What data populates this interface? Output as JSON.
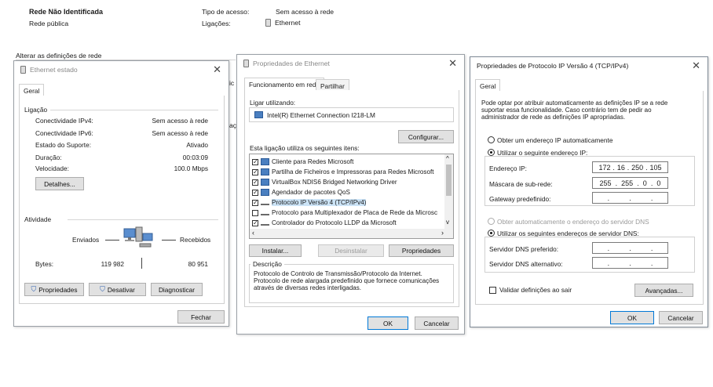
{
  "background": {
    "network_name": "Rede Não Identificada",
    "network_type": "Rede pública",
    "access_type_label": "Tipo de acesso:",
    "access_type_value": "Sem acesso à rede",
    "connections_label": "Ligações:",
    "connections_value": "Ethernet",
    "change_settings": "Alterar as definições de rede",
    "partial_1": "ic",
    "partial_2": "aç"
  },
  "status_window": {
    "title": "Ethernet estado",
    "tab": "Geral",
    "connection_label": "Ligação",
    "rows": [
      {
        "label": "Conectividade IPv4:",
        "value": "Sem acesso à rede"
      },
      {
        "label": "Conectividade IPv6:",
        "value": "Sem acesso à rede"
      },
      {
        "label": "Estado do Suporte:",
        "value": "Ativado"
      },
      {
        "label": "Duração:",
        "value": "00:03:09"
      },
      {
        "label": "Velocidade:",
        "value": "100.0 Mbps"
      }
    ],
    "details_button": "Detalhes...",
    "activity_label": "Atividade",
    "sent_label": "Enviados",
    "received_label": "Recebidos",
    "bytes_label": "Bytes:",
    "bytes_sent": "119 982",
    "bytes_received": "80 951",
    "properties_button": "Propriedades",
    "disable_button": "Desativar",
    "diagnose_button": "Diagnosticar",
    "close_button": "Fechar"
  },
  "props_window": {
    "title": "Propriedades de Ethernet",
    "tabs": [
      "Funcionamento em rede",
      "Partilhar"
    ],
    "connect_using_label": "Ligar utilizando:",
    "adapter_name": "Intel(R) Ethernet Connection I218-LM",
    "configure_button": "Configurar...",
    "items_label": "Esta ligação utiliza os seguintes itens:",
    "items": [
      {
        "label": "Cliente para Redes Microsoft",
        "checked": true
      },
      {
        "label": "Partilha de Ficheiros e Impressoras para Redes Microsoft",
        "checked": true
      },
      {
        "label": "VirtualBox NDIS6 Bridged Networking Driver",
        "checked": true
      },
      {
        "label": "Agendador de pacotes QoS",
        "checked": true
      },
      {
        "label": "Protocolo IP Versão 4 (TCP/IPv4)",
        "checked": true
      },
      {
        "label": "Protocolo para Multiplexador de Placa de Rede da Microsc",
        "checked": false
      },
      {
        "label": "Controlador do Protocolo LLDP da Microsoft",
        "checked": true
      }
    ],
    "install_button": "Instalar...",
    "uninstall_button": "Desinstalar",
    "properties_button": "Propriedades",
    "description_label": "Descrição",
    "description_text": "Protocolo de Controlo de Transmissão/Protocolo da Internet. Protocolo de rede alargada predefinido que fornece comunicações através de diversas redes interligadas.",
    "ok_button": "OK",
    "cancel_button": "Cancelar"
  },
  "ipv4_window": {
    "title": "Propriedades de Protocolo IP Versão 4 (TCP/IPv4)",
    "tab": "Geral",
    "intro": "Pode optar por atribuir automaticamente as definições IP se a rede suportar essa funcionalidade. Caso contrário tem de pedir ao administrador de rede as definições IP apropriadas.",
    "auto_ip": "Obter um endereço IP automaticamente",
    "manual_ip": "Utilizar o seguinte endereço IP:",
    "ip_label": "Endereço IP:",
    "ip_value": [
      "172",
      "16",
      "250",
      "105"
    ],
    "mask_label": "Máscara de sub-rede:",
    "mask_value": [
      "255",
      "255",
      "0",
      "0"
    ],
    "gateway_label": "Gateway predefinido:",
    "auto_dns": "Obter automaticamente o endereço do servidor DNS",
    "manual_dns": "Utilizar os seguintes endereços de servidor DNS:",
    "dns1_label": "Servidor DNS preferido:",
    "dns2_label": "Servidor DNS alternativo:",
    "validate_label": "Validar definições ao sair",
    "advanced_button": "Avançadas...",
    "ok_button": "OK",
    "cancel_button": "Cancelar"
  }
}
